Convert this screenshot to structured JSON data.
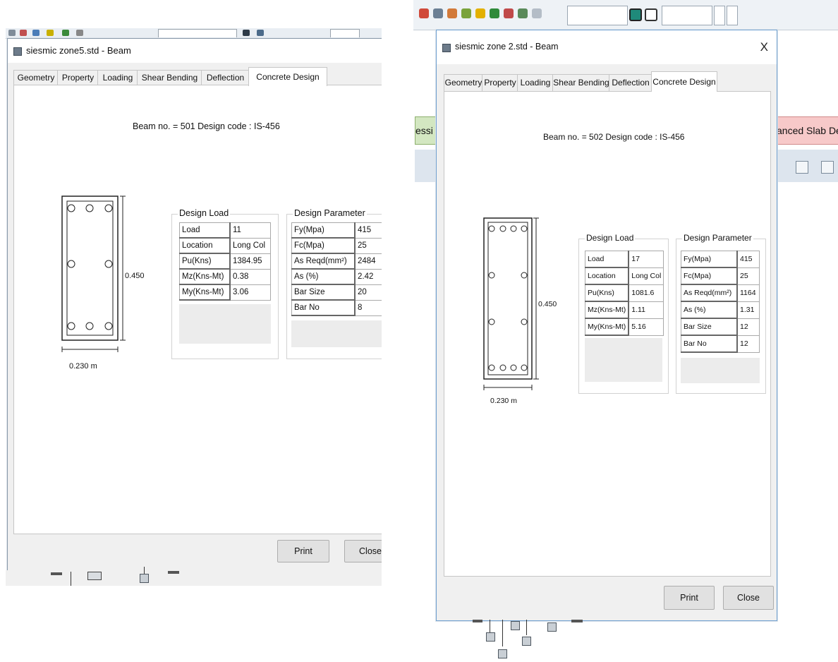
{
  "colors": {
    "window_bg": "#f0f0f0",
    "tab_body_bg": "#ffffff",
    "banner_left": "#d3e7c1",
    "banner_right": "#f7c9c9",
    "toolbar_bg": "#eef2f6"
  },
  "left_window": {
    "title": "siesmic zone5.std - Beam",
    "tabs": [
      "Geometry",
      "Property",
      "Loading",
      "Shear Bending",
      "Deflection",
      "Concrete Design"
    ],
    "active_tab": "Concrete Design",
    "heading": "Beam no. = 501  Design code :  IS-456",
    "section": {
      "depth_label": "0.450",
      "width_label": "0.230 m"
    },
    "design_load": {
      "title": "Design Load",
      "rows": [
        {
          "key": "Load",
          "value": "11"
        },
        {
          "key": "Location",
          "value": "Long Col"
        },
        {
          "key": "Pu(Kns)",
          "value": "1384.95"
        },
        {
          "key": "Mz(Kns-Mt)",
          "value": "0.38"
        },
        {
          "key": "My(Kns-Mt)",
          "value": "3.06"
        }
      ]
    },
    "design_parameter": {
      "title": "Design Parameter",
      "rows": [
        {
          "key": "Fy(Mpa)",
          "value": "415"
        },
        {
          "key": "Fc(Mpa)",
          "value": "25"
        },
        {
          "key": "As Reqd(mm²)",
          "value": "2484"
        },
        {
          "key": "As (%)",
          "value": "2.42"
        },
        {
          "key": "Bar Size",
          "value": "20"
        },
        {
          "key": "Bar No",
          "value": "8"
        }
      ]
    },
    "buttons": {
      "print": "Print",
      "close": "Close"
    }
  },
  "right_window": {
    "title": "siesmic zone 2.std - Beam",
    "close_glyph": "X",
    "tabs": [
      "Geometry",
      "Property",
      "Loading",
      "Shear Bending",
      "Deflection",
      "Concrete Design"
    ],
    "active_tab": "Concrete Design",
    "heading": "Beam no. = 502  Design code :  IS-456",
    "section": {
      "depth_label": "0.450",
      "width_label": "0.230 m"
    },
    "design_load": {
      "title": "Design Load",
      "rows": [
        {
          "key": "Load",
          "value": "17"
        },
        {
          "key": "Location",
          "value": "Long Col"
        },
        {
          "key": "Pu(Kns)",
          "value": "1081.6"
        },
        {
          "key": "Mz(Kns-Mt)",
          "value": "1.11"
        },
        {
          "key": "My(Kns-Mt)",
          "value": "5.16"
        }
      ]
    },
    "design_parameter": {
      "title": "Design Parameter",
      "rows": [
        {
          "key": "Fy(Mpa)",
          "value": "415"
        },
        {
          "key": "Fc(Mpa)",
          "value": "25"
        },
        {
          "key": "As Reqd(mm²)",
          "value": "1164"
        },
        {
          "key": "As (%)",
          "value": "1.31"
        },
        {
          "key": "Bar Size",
          "value": "12"
        },
        {
          "key": "Bar No",
          "value": "12"
        }
      ]
    },
    "buttons": {
      "print": "Print",
      "close": "Close"
    }
  },
  "background": {
    "banner_left_text": "essi",
    "banner_right_text": "anced Slab De"
  }
}
